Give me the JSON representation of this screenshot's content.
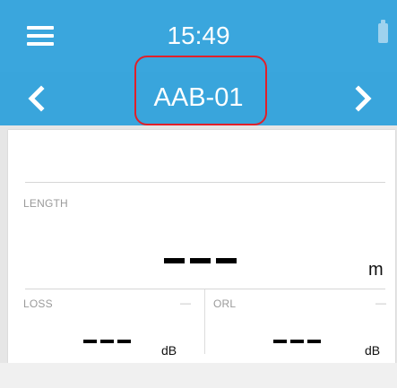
{
  "status_bar": {
    "time": "15:49",
    "menu_icon": "hamburger-menu-icon",
    "battery_icon": "battery-icon"
  },
  "nav": {
    "title": "AAB-01",
    "prev_icon": "chevron-left-icon",
    "next_icon": "chevron-right-icon"
  },
  "length": {
    "label": "LENGTH",
    "value": "---",
    "unit": "m"
  },
  "loss": {
    "label": "LOSS",
    "indicator": "—",
    "value": "---",
    "unit": "dB"
  },
  "orl": {
    "label": "ORL",
    "indicator": "—",
    "value": "---",
    "unit": "dB"
  },
  "colors": {
    "header": "#3aa6dd",
    "highlight": "#e0202a"
  }
}
